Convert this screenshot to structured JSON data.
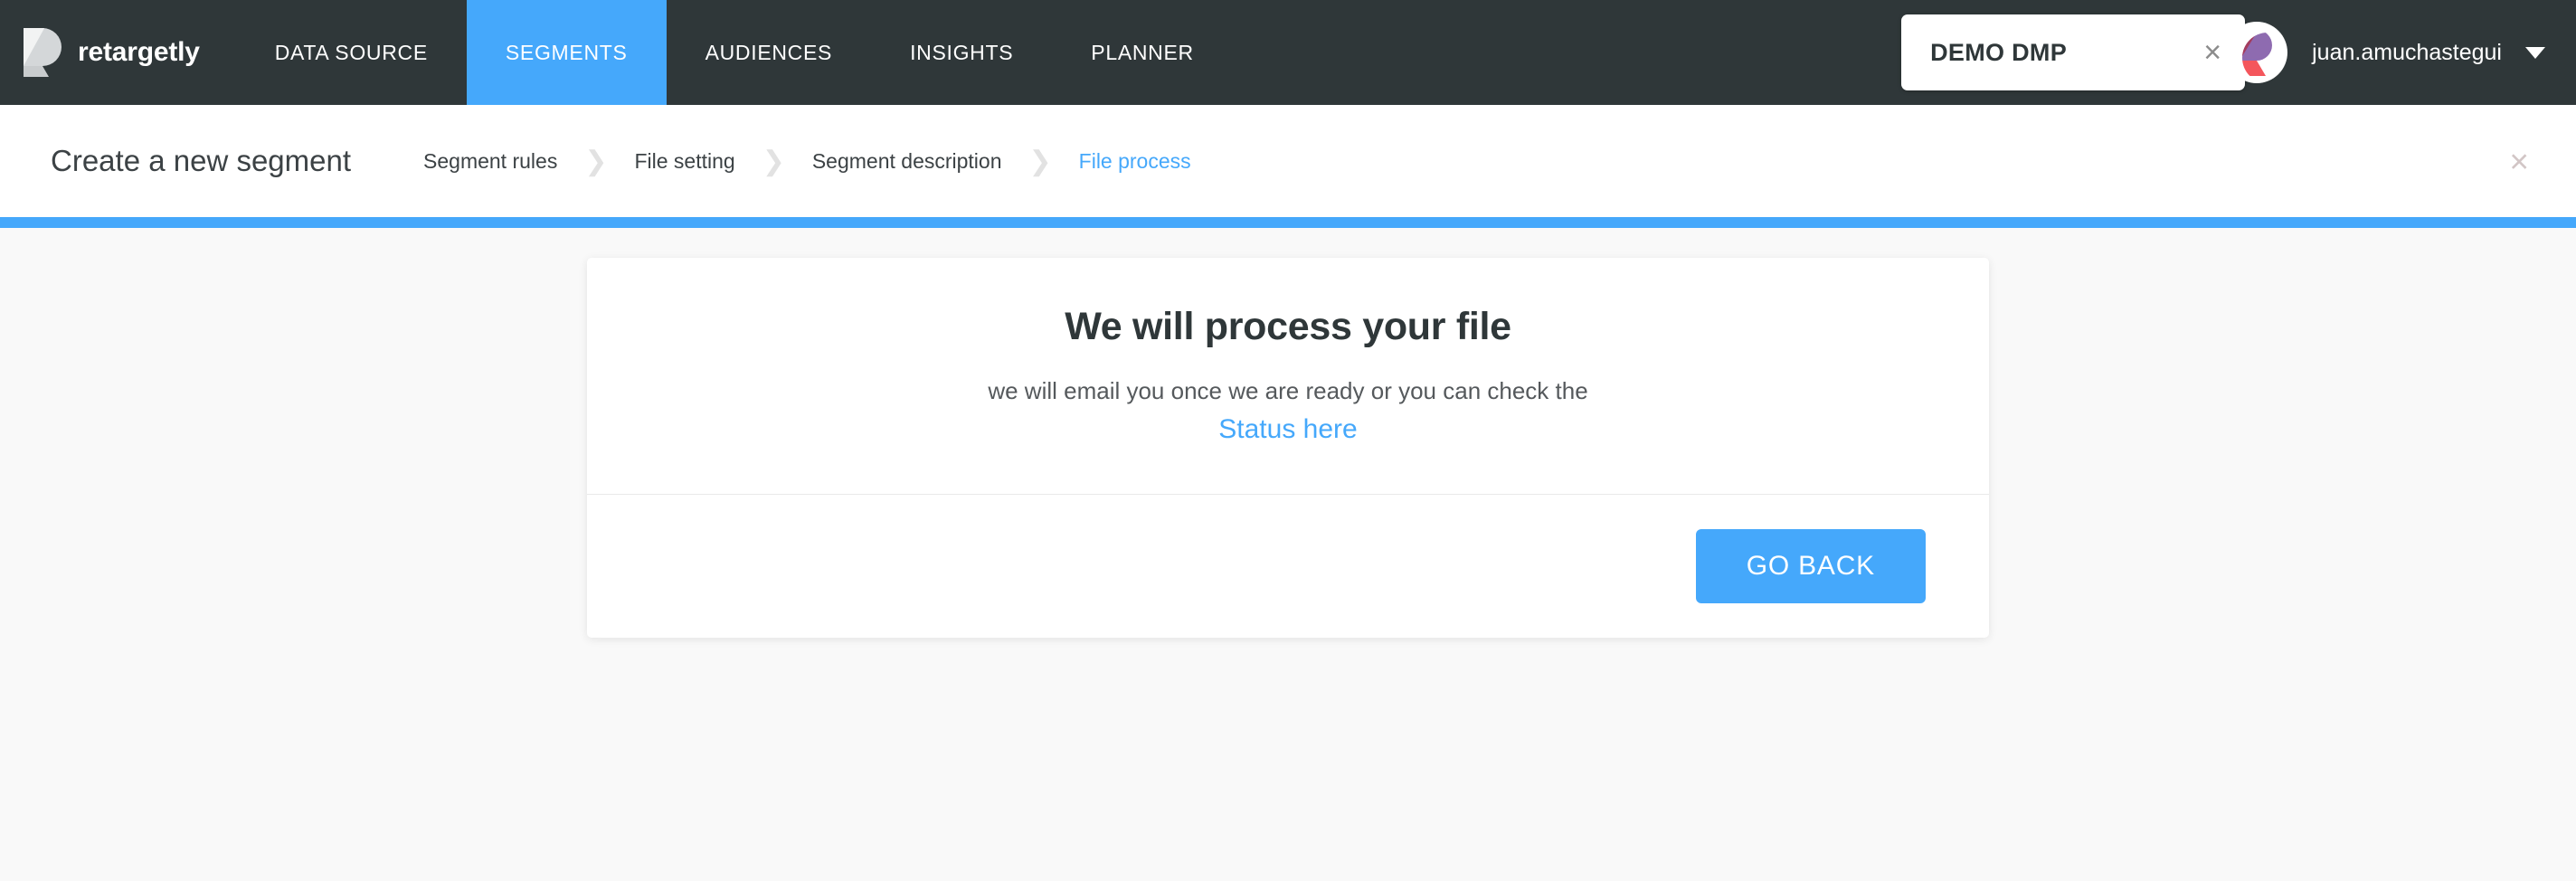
{
  "brand": {
    "name": "retargetly",
    "logo_icon": "retargetly-r-logo"
  },
  "nav": {
    "items": [
      {
        "label": "DATA SOURCE",
        "active": false
      },
      {
        "label": "SEGMENTS",
        "active": true
      },
      {
        "label": "AUDIENCES",
        "active": false
      },
      {
        "label": "INSIGHTS",
        "active": false
      },
      {
        "label": "PLANNER",
        "active": false
      }
    ]
  },
  "account": {
    "dmp_name": "DEMO DMP",
    "dmp_clear_icon": "×",
    "avatar_icon": "user-avatar",
    "username": "juan.amuchastegui",
    "chevron_icon": "chevron-down-icon"
  },
  "wizard": {
    "title": "Create a new segment",
    "separator": "❯",
    "steps": [
      {
        "label": "Segment rules",
        "active": false
      },
      {
        "label": "File setting",
        "active": false
      },
      {
        "label": "Segment description",
        "active": false
      },
      {
        "label": "File process",
        "active": true
      }
    ],
    "close_icon": "×"
  },
  "card": {
    "title": "We will process your file",
    "subtitle": "we will email you once we are ready or you can check the",
    "status_link": "Status here",
    "go_back_label": "GO BACK"
  },
  "colors": {
    "header_bg": "#2f3739",
    "accent": "#45a8fb",
    "page_bg": "#f9f9f9",
    "card_bg": "#ffffff",
    "text_dark": "#2f3739",
    "text_muted": "#55595c"
  }
}
